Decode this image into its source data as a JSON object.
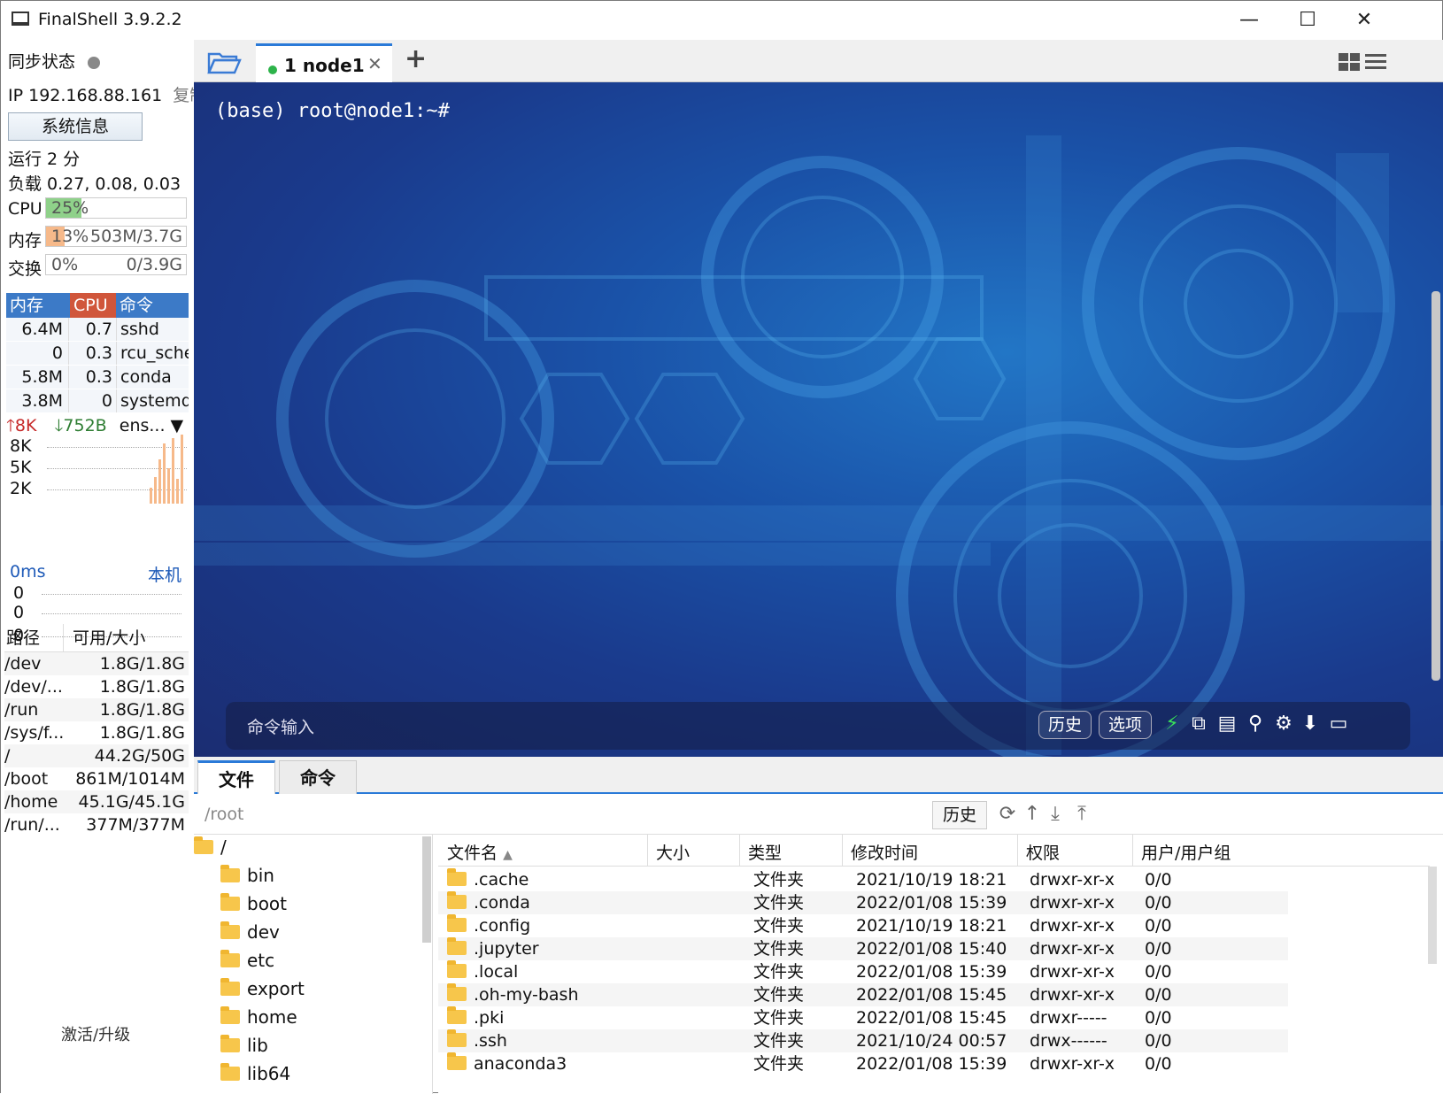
{
  "app": {
    "title": "FinalShell 3.9.2.2"
  },
  "window_controls": {
    "minimize": "—",
    "maximize": "☐",
    "close": "✕"
  },
  "left": {
    "sync_label": "同步状态",
    "ip_label": "IP 192.168.88.161",
    "copy_label": "复制",
    "sysinfo_button": "系统信息",
    "uptime": "运行 2 分",
    "load": "负载 0.27, 0.08, 0.03",
    "cpu": {
      "label": "CPU",
      "text": "25%",
      "percent": 25,
      "color": "#8fd18a"
    },
    "mem": {
      "label": "内存",
      "text": "13%",
      "detail": "503M/3.7G",
      "percent": 13,
      "color": "#f6b98a"
    },
    "swap": {
      "label": "交换",
      "text": "0%",
      "detail": "0/3.9G",
      "percent": 0
    },
    "proc_headers": [
      "内存",
      "CPU",
      "命令"
    ],
    "procs": [
      {
        "mem": "6.4M",
        "cpu": "0.7",
        "cmd": "sshd"
      },
      {
        "mem": "0",
        "cpu": "0.3",
        "cmd": "rcu_sche"
      },
      {
        "mem": "5.8M",
        "cpu": "0.3",
        "cmd": "conda"
      },
      {
        "mem": "3.8M",
        "cpu": "0",
        "cmd": "systemd"
      }
    ],
    "net": {
      "up": "8K",
      "down": "752B",
      "iface": "ens...",
      "ticks": [
        "8K",
        "5K",
        "2K"
      ]
    },
    "ping": {
      "latency": "0ms",
      "target": "本机",
      "ticks": [
        "0",
        "0",
        "0"
      ]
    },
    "disk_headers": [
      "路径",
      "可用/大小"
    ],
    "disks": [
      {
        "path": "/dev",
        "size": "1.8G/1.8G"
      },
      {
        "path": "/dev/...",
        "size": "1.8G/1.8G"
      },
      {
        "path": "/run",
        "size": "1.8G/1.8G"
      },
      {
        "path": "/sys/f...",
        "size": "1.8G/1.8G"
      },
      {
        "path": "/",
        "size": "44.2G/50G"
      },
      {
        "path": "/boot",
        "size": "861M/1014M"
      },
      {
        "path": "/home",
        "size": "45.1G/45.1G"
      },
      {
        "path": "/run/...",
        "size": "377M/377M"
      }
    ],
    "activate": "激活/升级"
  },
  "tabs": {
    "session": "1 node1",
    "close": "✕",
    "add": "+"
  },
  "terminal": {
    "prompt": "(base) root@node1:~#",
    "cmd_placeholder": "命令输入",
    "history_btn": "历史",
    "options_btn": "选项"
  },
  "bottom_tabs": {
    "files": "文件",
    "commands": "命令"
  },
  "path_bar": {
    "path": "/root",
    "history_btn": "历史"
  },
  "tree": {
    "root": "/",
    "items": [
      "bin",
      "boot",
      "dev",
      "etc",
      "export",
      "home",
      "lib",
      "lib64"
    ]
  },
  "files": {
    "headers": {
      "name": "文件名",
      "size": "大小",
      "type": "类型",
      "mtime": "修改时间",
      "perm": "权限",
      "owner": "用户/用户组"
    },
    "rows": [
      {
        "name": ".cache",
        "type": "文件夹",
        "mtime": "2021/10/19 18:21",
        "perm": "drwxr-xr-x",
        "owner": "0/0"
      },
      {
        "name": ".conda",
        "type": "文件夹",
        "mtime": "2022/01/08 15:39",
        "perm": "drwxr-xr-x",
        "owner": "0/0"
      },
      {
        "name": ".config",
        "type": "文件夹",
        "mtime": "2021/10/19 18:21",
        "perm": "drwxr-xr-x",
        "owner": "0/0"
      },
      {
        "name": ".jupyter",
        "type": "文件夹",
        "mtime": "2022/01/08 15:40",
        "perm": "drwxr-xr-x",
        "owner": "0/0"
      },
      {
        "name": ".local",
        "type": "文件夹",
        "mtime": "2022/01/08 15:39",
        "perm": "drwxr-xr-x",
        "owner": "0/0"
      },
      {
        "name": ".oh-my-bash",
        "type": "文件夹",
        "mtime": "2022/01/08 15:45",
        "perm": "drwxr-xr-x",
        "owner": "0/0"
      },
      {
        "name": ".pki",
        "type": "文件夹",
        "mtime": "2022/01/08 15:45",
        "perm": "drwxr-----",
        "owner": "0/0"
      },
      {
        "name": ".ssh",
        "type": "文件夹",
        "mtime": "2021/10/24 00:57",
        "perm": "drwx------",
        "owner": "0/0"
      },
      {
        "name": "anaconda3",
        "type": "文件夹",
        "mtime": "2022/01/08 15:39",
        "perm": "drwxr-xr-x",
        "owner": "0/0"
      }
    ]
  }
}
